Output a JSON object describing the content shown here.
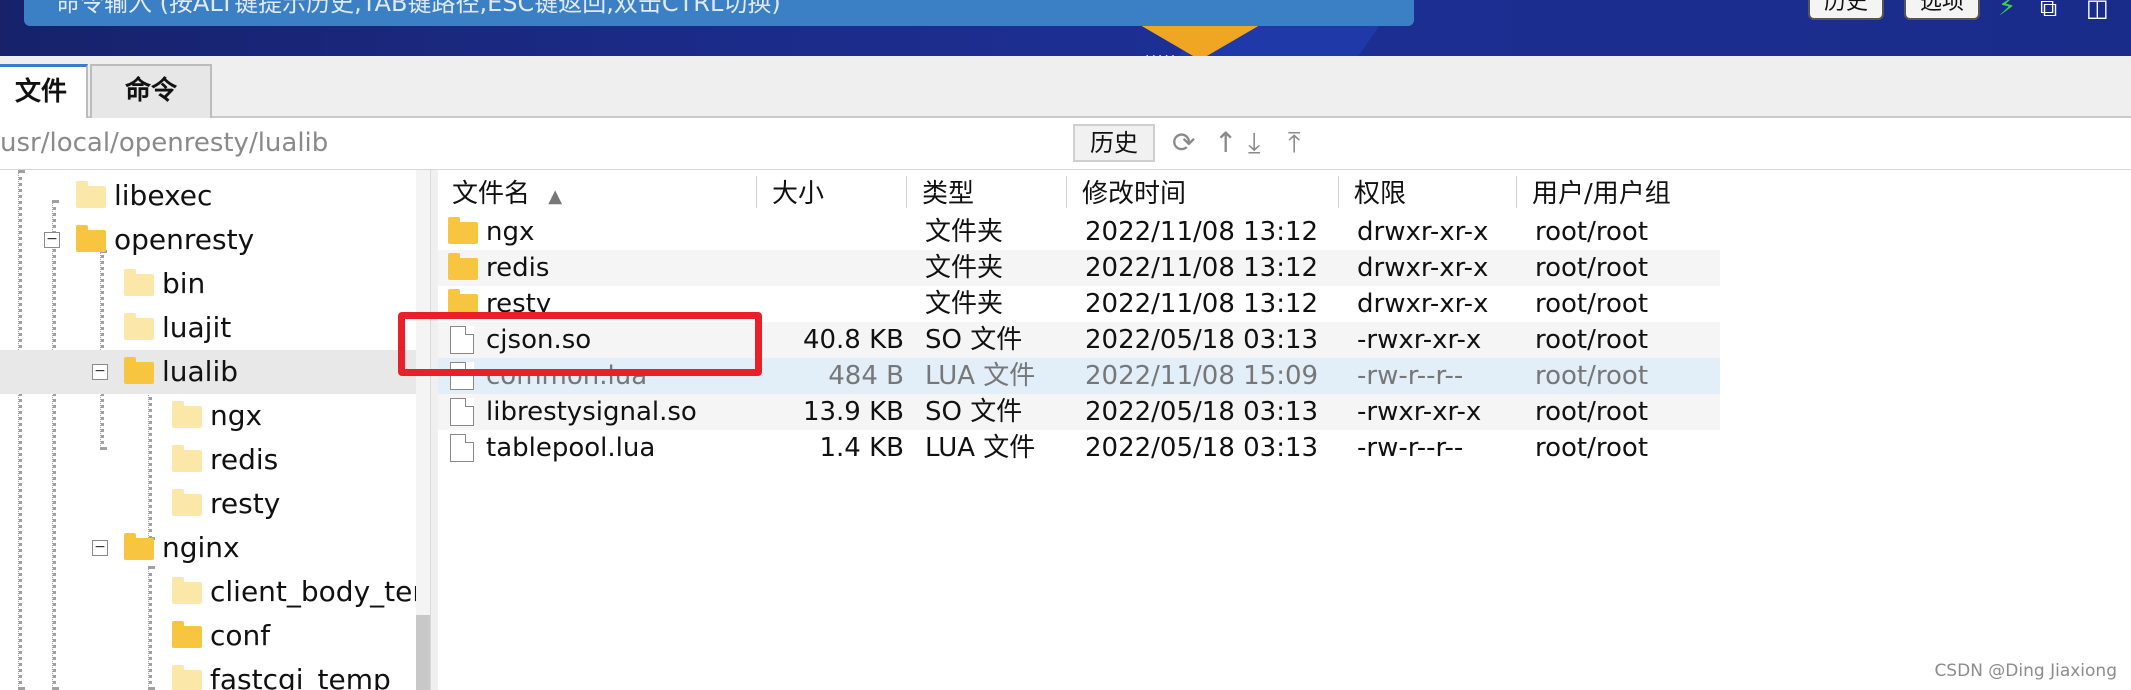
{
  "command_bar": {
    "input_text": "命令输入 (按ALT键提示历史,TAB键路径,ESC键返回,双击CTRL切换)",
    "history_button": "历史",
    "options_button": "选项"
  },
  "tabs": [
    {
      "label": "文件",
      "active": true
    },
    {
      "label": "命令",
      "active": false
    }
  ],
  "path_bar": {
    "path": "usr/local/openresty/lualib",
    "history_button": "历史",
    "tools": [
      "refresh-icon",
      "up-dir-icon",
      "download-icon",
      "upload-icon"
    ]
  },
  "tree": {
    "items": [
      {
        "label": "libexec"
      },
      {
        "label": "openresty"
      },
      {
        "label": "bin"
      },
      {
        "label": "luajit"
      },
      {
        "label": "lualib",
        "selected": true
      },
      {
        "label": "ngx"
      },
      {
        "label": "redis"
      },
      {
        "label": "resty"
      },
      {
        "label": "nginx"
      },
      {
        "label": "client_body_temp"
      },
      {
        "label": "conf"
      },
      {
        "label": "fastcgi_temp"
      }
    ]
  },
  "file_list": {
    "columns": [
      "文件名",
      "大小",
      "类型",
      "修改时间",
      "权限",
      "用户/用户组"
    ],
    "sort_indicator": "▲",
    "rows": [
      {
        "name": "ngx",
        "size": "",
        "type": "文件夹",
        "modified": "2022/11/08 13:12",
        "perm": "drwxr-xr-x",
        "owner": "root/root",
        "kind": "folder"
      },
      {
        "name": "redis",
        "size": "",
        "type": "文件夹",
        "modified": "2022/11/08 13:12",
        "perm": "drwxr-xr-x",
        "owner": "root/root",
        "kind": "folder"
      },
      {
        "name": "resty",
        "size": "",
        "type": "文件夹",
        "modified": "2022/11/08 13:12",
        "perm": "drwxr-xr-x",
        "owner": "root/root",
        "kind": "folder"
      },
      {
        "name": "cjson.so",
        "size": "40.8 KB",
        "type": "SO 文件",
        "modified": "2022/05/18 03:13",
        "perm": "-rwxr-xr-x",
        "owner": "root/root",
        "kind": "file"
      },
      {
        "name": "common.lua",
        "size": "484 B",
        "type": "LUA 文件",
        "modified": "2022/11/08 15:09",
        "perm": "-rw-r--r--",
        "owner": "root/root",
        "kind": "file"
      },
      {
        "name": "librestysignal.so",
        "size": "13.9 KB",
        "type": "SO 文件",
        "modified": "2022/05/18 03:13",
        "perm": "-rwxr-xr-x",
        "owner": "root/root",
        "kind": "file"
      },
      {
        "name": "tablepool.lua",
        "size": "1.4 KB",
        "type": "LUA 文件",
        "modified": "2022/05/18 03:13",
        "perm": "-rw-r--r--",
        "owner": "root/root",
        "kind": "file"
      }
    ]
  },
  "watermark": "CSDN @Ding Jiaxiong",
  "colors": {
    "highlight_box": "#e8202a",
    "accent": "#3a7bd5",
    "folder": "#f8c541"
  }
}
